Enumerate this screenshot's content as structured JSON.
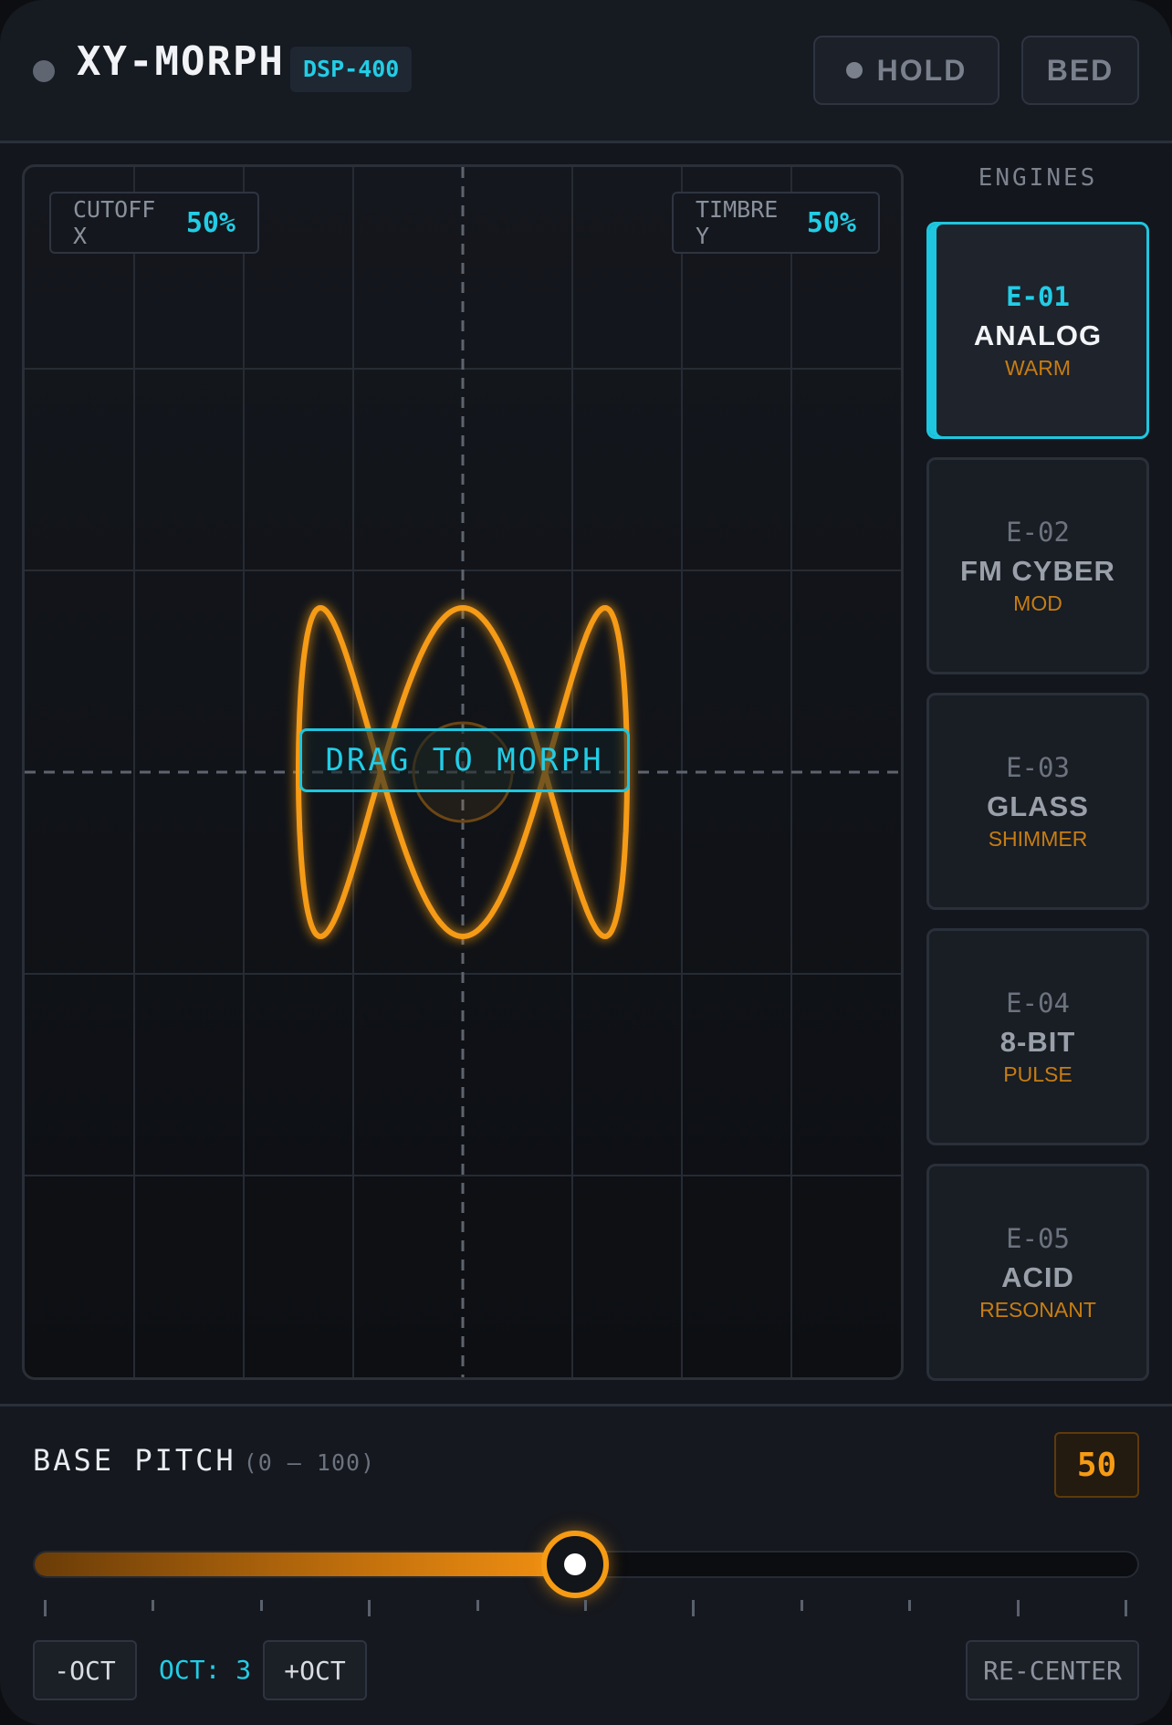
{
  "header": {
    "title": "XY-MORPH",
    "model": "DSP-400",
    "hold_label": "HOLD",
    "bed_label": "BED"
  },
  "pad": {
    "x_label": "CUTOFF X",
    "x_value": "50%",
    "y_label": "TIMBRE Y",
    "y_value": "50%",
    "hint": "DRAG TO MORPH"
  },
  "engines": {
    "title": "ENGINES",
    "items": [
      {
        "code": "E-01",
        "name": "ANALOG",
        "tag": "WARM",
        "active": true
      },
      {
        "code": "E-02",
        "name": "FM CYBER",
        "tag": "MOD",
        "active": false
      },
      {
        "code": "E-03",
        "name": "GLASS",
        "tag": "SHIMMER",
        "active": false
      },
      {
        "code": "E-04",
        "name": "8-BIT",
        "tag": "PULSE",
        "active": false
      },
      {
        "code": "E-05",
        "name": "ACID",
        "tag": "RESONANT",
        "active": false
      }
    ]
  },
  "pitch": {
    "label": "BASE PITCH",
    "range": "(0 – 100)",
    "value": "50",
    "level": 0.5
  },
  "octave": {
    "down_label": "-OCT",
    "readout": "OCT: 3",
    "up_label": "+OCT",
    "recenter_label": "RE-CENTER"
  },
  "colors": {
    "accent": "#22cde6",
    "trace": "#f59b14"
  }
}
